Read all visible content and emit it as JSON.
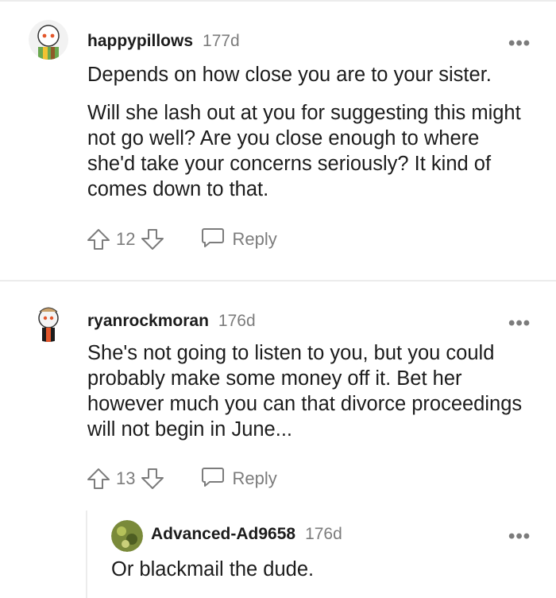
{
  "comments": [
    {
      "username": "happypillows",
      "age": "177d",
      "body": [
        "Depends on how close you are to your sister.",
        "Will she lash out at you for suggesting this might not go well? Are you close enough to where she'd take your concerns seriously? It kind of comes down to that."
      ],
      "score": "12",
      "reply_label": "Reply"
    },
    {
      "username": "ryanrockmoran",
      "age": "176d",
      "body": [
        "She's not going to listen to you, but you could probably make some money off it. Bet her however much you can that divorce proceedings will not begin in June..."
      ],
      "score": "13",
      "reply_label": "Reply"
    },
    {
      "username": "Advanced-Ad9658",
      "age": "176d",
      "body": [
        "Or blackmail the dude."
      ]
    }
  ],
  "more_label": "•••",
  "colors": {
    "text": "#1c1c1c",
    "muted": "#7c7c7c",
    "divider": "#ececec"
  }
}
